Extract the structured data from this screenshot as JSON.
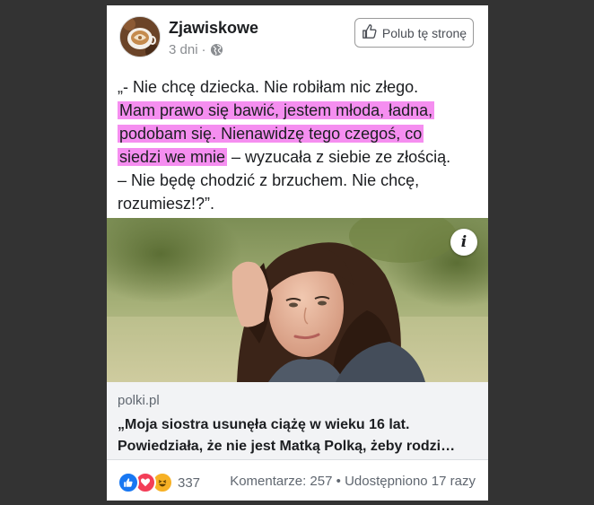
{
  "post": {
    "page_name": "Zjawiskowe",
    "time": "3 dni",
    "separator": "·",
    "privacy_icon": "globe-icon",
    "like_page_icon": "thumbs-up-icon",
    "like_page_label": "Polub tę stronę",
    "text": {
      "line1": "„- Nie chcę dziecka. Nie robiłam nic złego.",
      "hl1": "Mam prawo się bawić, jestem młoda, ładna,",
      "hl2": "podobam się. Nienawidzę tego czegoś, co",
      "hl3": "siedzi we mnie",
      "rest3": " – wyzucała z siebie ze złością.",
      "line4": "– Nie będę chodzić z brzuchem. Nie chcę,",
      "line5": "rozumiesz!?”."
    },
    "highlight_color": "#f58ef0"
  },
  "link": {
    "info_icon": "info-icon",
    "info_label": "i",
    "domain": "polki.pl",
    "title_line1": "„Moja siostra usunęła ciążę w wieku 16 lat.",
    "title_line2": "Powiedziała, że nie jest Matką Polką, żeby rodzi…"
  },
  "footer": {
    "reaction_icons": [
      "like-reaction-icon",
      "love-reaction-icon",
      "haha-reaction-icon"
    ],
    "reaction_count": "337",
    "comments": "Komentarze: 257",
    "dot": "•",
    "shares": "Udostępniono 17 razy"
  },
  "colors": {
    "background": "#333333",
    "like_blue": "#1877f2",
    "love_red": "#f33e58",
    "haha_yellow": "#f7b125"
  }
}
